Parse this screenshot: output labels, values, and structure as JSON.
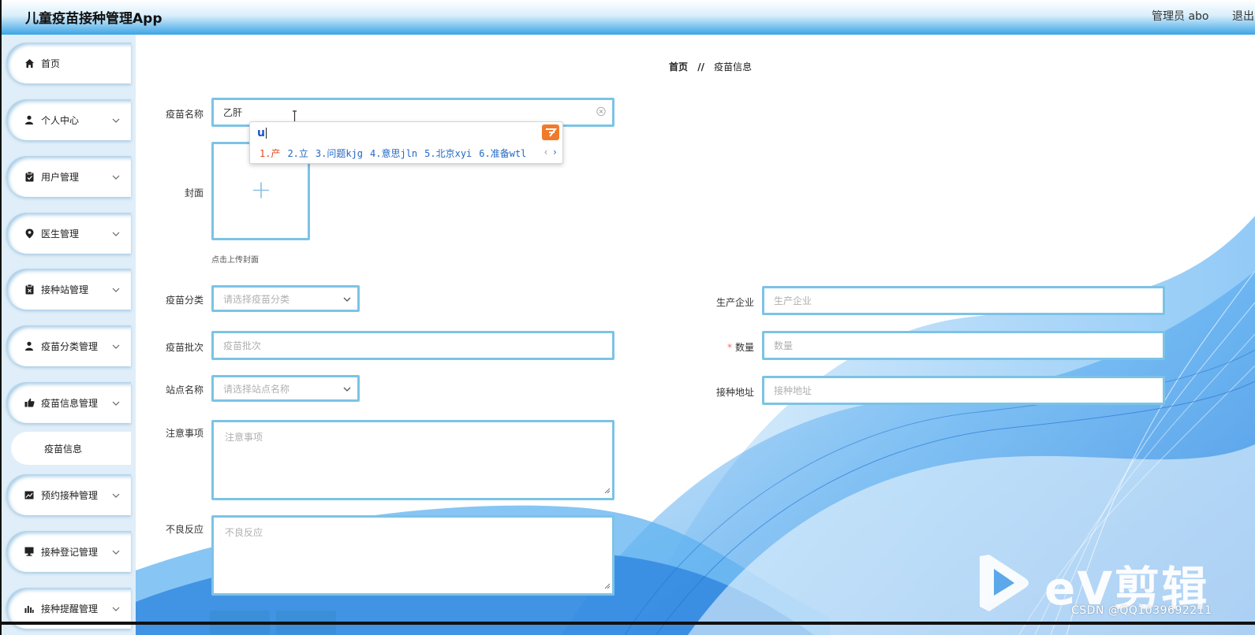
{
  "header": {
    "app_title": "儿童疫苗接种管理App",
    "user_label": "管理员 abo",
    "logout_label": "退出"
  },
  "sidebar": {
    "items": [
      {
        "label": "首页",
        "icon": "home-icon",
        "has_chevron": false
      },
      {
        "label": "个人中心",
        "icon": "user-icon",
        "has_chevron": true
      },
      {
        "label": "用户管理",
        "icon": "clipboard-icon",
        "has_chevron": true
      },
      {
        "label": "医生管理",
        "icon": "pin-icon",
        "has_chevron": true
      },
      {
        "label": "接种站管理",
        "icon": "clipboard-x-icon",
        "has_chevron": true
      },
      {
        "label": "疫苗分类管理",
        "icon": "user-icon",
        "has_chevron": true
      },
      {
        "label": "疫苗信息管理",
        "icon": "thumbs-up-icon",
        "has_chevron": true
      },
      {
        "label": "预约接种管理",
        "icon": "chart-icon",
        "has_chevron": true
      },
      {
        "label": "接种登记管理",
        "icon": "monitor-icon",
        "has_chevron": true
      },
      {
        "label": "接种提醒管理",
        "icon": "bar-chart-icon",
        "has_chevron": true
      }
    ],
    "active_submenu": "疫苗信息"
  },
  "breadcrumb": {
    "home": "首页",
    "separator": "//",
    "current": "疫苗信息"
  },
  "form": {
    "vaccine_name": {
      "label": "疫苗名称",
      "value": "乙肝"
    },
    "cover": {
      "label": "封面",
      "tip": "点击上传封面"
    },
    "category": {
      "label": "疫苗分类",
      "placeholder": "请选择疫苗分类"
    },
    "manufacturer": {
      "label": "生产企业",
      "placeholder": "生产企业"
    },
    "batch": {
      "label": "疫苗批次",
      "placeholder": "疫苗批次"
    },
    "quantity": {
      "label": "数量",
      "placeholder": "数量",
      "required_mark": "*"
    },
    "station": {
      "label": "站点名称",
      "placeholder": "请选择站点名称"
    },
    "address": {
      "label": "接种地址",
      "placeholder": "接种地址"
    },
    "notes": {
      "label": "注意事项",
      "placeholder": "注意事项"
    },
    "adverse": {
      "label": "不良反应",
      "placeholder": "不良反应"
    }
  },
  "ime_popup": {
    "composition": "u",
    "candidates": [
      "1.产",
      "2.立",
      "3.问题kjg",
      "4.意思jln",
      "5.北京xyi",
      "6.准备wtl"
    ]
  },
  "watermark": {
    "brand": "eV剪辑",
    "credit": "CSDN @QQ1039692211"
  },
  "colors": {
    "accent": "#3aa4e6",
    "input_border": "#7cc3e6",
    "sidebar_bg": "#dfeef8",
    "required": "#f56c6c",
    "ime_logo": "#f07a2a"
  }
}
